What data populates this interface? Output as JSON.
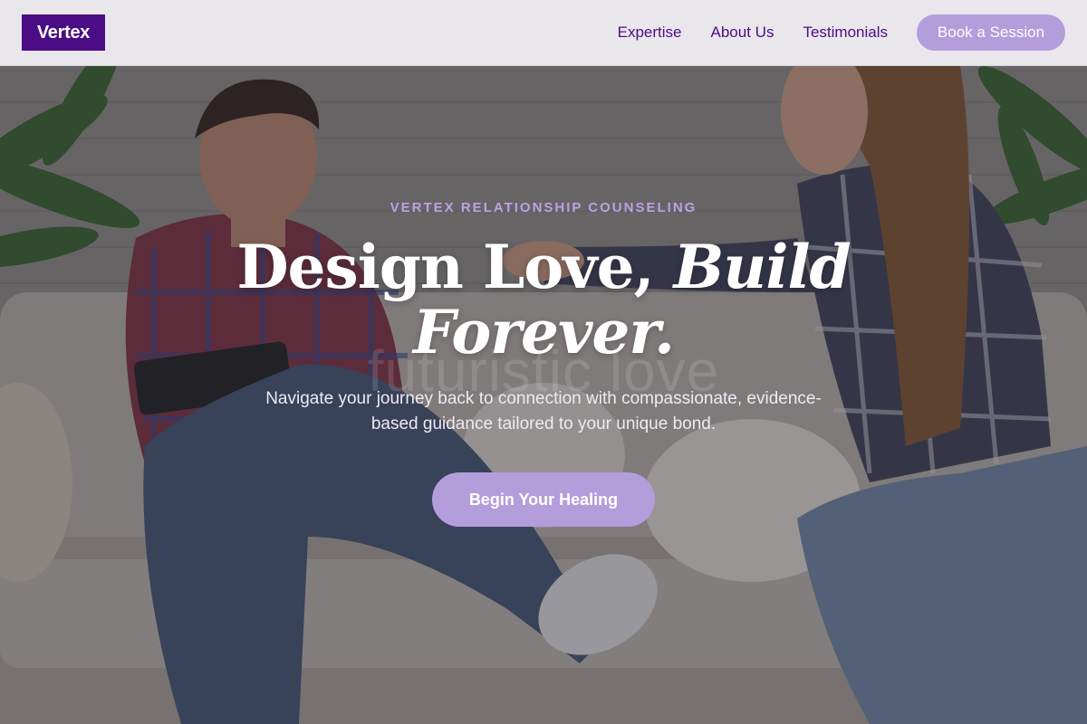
{
  "nav": {
    "logo": "Vertex",
    "links": [
      "Expertise",
      "About Us",
      "Testimonials"
    ],
    "cta_label": "Book a Session"
  },
  "hero": {
    "eyebrow": "VERTEX RELATIONSHIP COUNSELING",
    "headline_plain": "Design Love,",
    "headline_italic": "Build Forever.",
    "watermark": "futuristic love",
    "subtext": "Navigate your journey back to connection with compassionate, evidence-based guidance tailored to your unique bond.",
    "cta_label": "Begin Your Healing",
    "background_image": "couple-on-sofa-photo"
  },
  "colors": {
    "brand_purple": "#4b0d85",
    "accent_lavender": "#b39ddb",
    "eyebrow_lavender": "#b9a3e3",
    "nav_background": "#e9e7ec"
  }
}
